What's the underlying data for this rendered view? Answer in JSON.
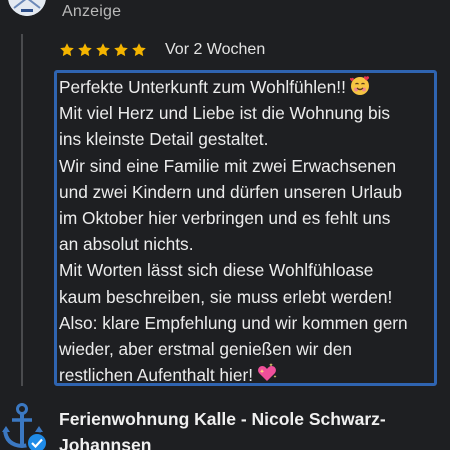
{
  "header": {
    "label": "Anzeige"
  },
  "review": {
    "rating": 5,
    "rating_max": 5,
    "age": "Vor 2 Wochen",
    "lines": [
      "Perfekte Unterkunft zum Wohlfühlen!!",
      "Mit viel Herz und Liebe ist die Wohnung bis",
      "ins kleinste Detail gestaltet.",
      "Wir sind eine Familie mit zwei Erwachsenen",
      "und zwei Kindern und dürfen unseren Urlaub",
      "im Oktober hier verbringen und es fehlt uns",
      "an absolut nichts.",
      "Mit Worten lässt sich diese Wohlfühloase",
      "kaum beschreiben, sie muss erlebt werden!",
      "Also: klare Empfehlung und wir kommen gern",
      "wieder, aber erstmal genießen wir den",
      "restlichen Aufenthalt hier!"
    ],
    "emojis": [
      "smiling-face-with-hearts",
      "sparkling-heart"
    ]
  },
  "reply": {
    "author": "Ferienwohnung Kalle - Nicole Schwarz-Johannsen",
    "verified": true,
    "avatar_icon": "anchor-icon"
  },
  "colors": {
    "background": "#1e1f22",
    "star": "#f4b400",
    "focus_border": "#2f64b1",
    "verified": "#1f8be8"
  }
}
